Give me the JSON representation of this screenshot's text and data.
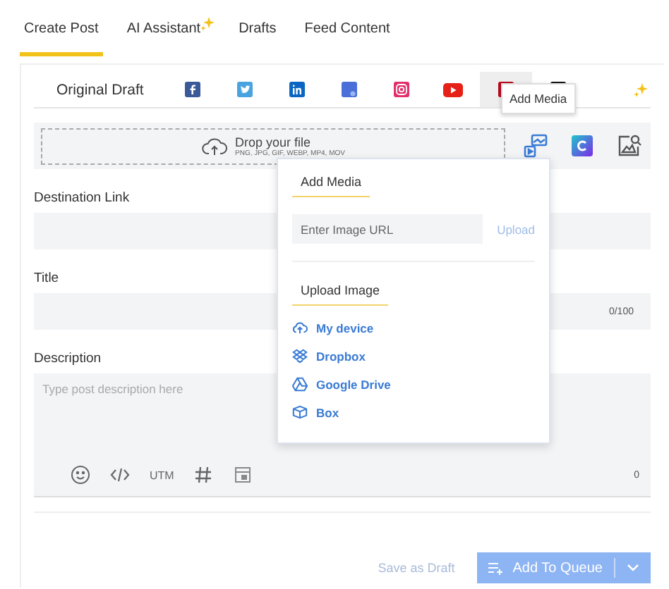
{
  "tabs": [
    {
      "label": "Create Post",
      "selected": true,
      "sparkle": false
    },
    {
      "label": "AI Assistant",
      "selected": false,
      "sparkle": true
    },
    {
      "label": "Drafts",
      "selected": false,
      "sparkle": false
    },
    {
      "label": "Feed Content",
      "selected": false,
      "sparkle": false
    }
  ],
  "platform_tabs": [
    {
      "kind": "text",
      "label": "Original Draft",
      "selected": false
    },
    {
      "kind": "facebook",
      "selected": false
    },
    {
      "kind": "twitter",
      "selected": false
    },
    {
      "kind": "linkedin",
      "selected": false
    },
    {
      "kind": "gbp",
      "selected": false
    },
    {
      "kind": "instagram",
      "selected": false
    },
    {
      "kind": "youtube",
      "selected": false
    },
    {
      "kind": "pinterest",
      "selected": true
    },
    {
      "kind": "tiktok",
      "selected": false
    }
  ],
  "media": {
    "drop_title": "Drop your file",
    "drop_formats": "PNG, JPG, GIF, WEBP, MP4, MOV",
    "tooltip": "Add Media"
  },
  "popup": {
    "add_media_title": "Add Media",
    "url_placeholder": "Enter Image URL",
    "upload_button": "Upload",
    "upload_title": "Upload Image",
    "sources": [
      {
        "kind": "device",
        "label": "My device"
      },
      {
        "kind": "dropbox",
        "label": "Dropbox"
      },
      {
        "kind": "drive",
        "label": "Google Drive"
      },
      {
        "kind": "box",
        "label": "Box"
      }
    ]
  },
  "fields": [
    {
      "kind": "input",
      "label": "Destination Link"
    },
    {
      "kind": "input",
      "label": "Title",
      "counter": "0/100"
    },
    {
      "kind": "textarea",
      "label": "Description",
      "placeholder": "Type post description here",
      "counter": "0",
      "tool_text": "UTM"
    }
  ],
  "footer": {
    "draft": "Save as Draft",
    "queue": "Add To Queue"
  }
}
